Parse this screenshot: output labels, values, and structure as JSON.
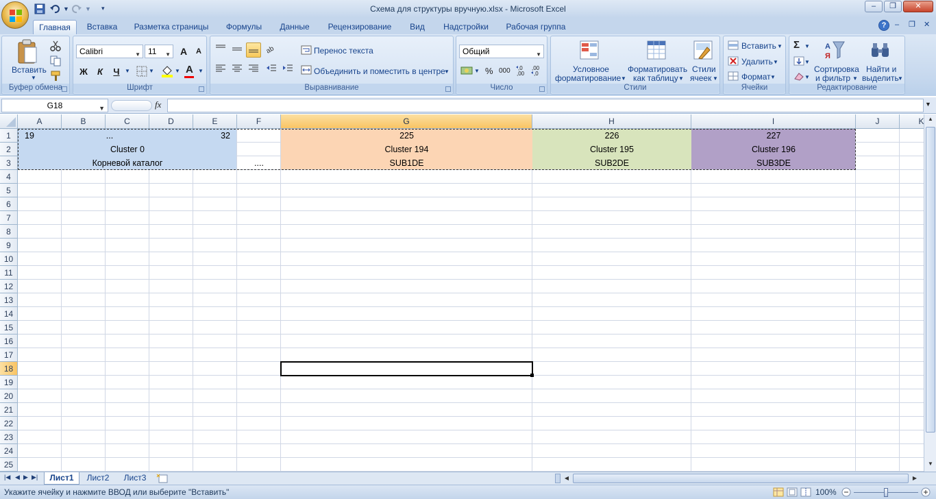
{
  "window": {
    "title": "Схема для структуры вручную.xlsx - Microsoft Excel",
    "minimize": "–",
    "restore": "❐",
    "close": "✕",
    "doc_min": "–",
    "doc_restore": "❐",
    "doc_close": "✕",
    "help": "?"
  },
  "tabs": [
    "Главная",
    "Вставка",
    "Разметка страницы",
    "Формулы",
    "Данные",
    "Рецензирование",
    "Вид",
    "Надстройки",
    "Рабочая группа"
  ],
  "ribbon": {
    "clipboard": {
      "label": "Буфер обмена",
      "paste": "Вставить"
    },
    "font": {
      "label": "Шрифт",
      "name": "Calibri",
      "size": "11",
      "bold": "Ж",
      "italic": "К",
      "underline": "Ч",
      "grow": "A",
      "shrink": "A",
      "color_letter": "A"
    },
    "align": {
      "label": "Выравнивание",
      "wrap": "Перенос текста",
      "merge": "Объединить и поместить в центре"
    },
    "number": {
      "label": "Число",
      "format": "Общий",
      "percent": "%",
      "thousands": "000",
      "inc_dec": ",0\n,00",
      "dec_dec": ",00\n,0"
    },
    "styles": {
      "label": "Стили",
      "cond_line1": "Условное",
      "cond_line2": "форматирование",
      "table_line1": "Форматировать",
      "table_line2": "как таблицу",
      "cell_line1": "Стили",
      "cell_line2": "ячеек"
    },
    "cells": {
      "label": "Ячейки",
      "insert": "Вставить",
      "delete": "Удалить",
      "format": "Формат"
    },
    "editing": {
      "label": "Редактирование",
      "sigma": "Σ",
      "sort_line1": "Сортировка",
      "sort_line2": "и фильтр",
      "find_line1": "Найти и",
      "find_line2": "выделить"
    }
  },
  "formula": {
    "name_box": "G18",
    "fx": "fx",
    "value": ""
  },
  "grid": {
    "columns": [
      "A",
      "B",
      "C",
      "D",
      "E",
      "F",
      "G",
      "H",
      "I",
      "J",
      "K"
    ],
    "rows": [
      "1",
      "2",
      "3",
      "4",
      "5",
      "6",
      "7",
      "8",
      "9",
      "10",
      "11",
      "12",
      "13",
      "14",
      "15",
      "16",
      "17",
      "18",
      "19",
      "20",
      "21",
      "22",
      "23",
      "24",
      "25"
    ],
    "selected_col": "G",
    "selected_row": "18",
    "cells": {
      "a1": "19",
      "c1": "...",
      "e1": "32",
      "a2": "Cluster 0",
      "a3": "Корневой каталог",
      "f3": "....",
      "g1": "225",
      "g2": "Cluster 194",
      "g3": "SUB1DE",
      "h1": "226",
      "h2": "Cluster 195",
      "h3": "SUB2DE",
      "i1": "227",
      "i2": "Cluster 196",
      "i3": "SUB3DE"
    },
    "colors": {
      "blue": "#c5d9f1",
      "orange": "#fcd5b4",
      "green": "#d8e4bc",
      "purple": "#b1a0c7"
    }
  },
  "sheets": [
    "Лист1",
    "Лист2",
    "Лист3"
  ],
  "status": {
    "text": "Укажите ячейку и нажмите ВВОД или выберите \"Вставить\"",
    "zoom": "100%"
  }
}
